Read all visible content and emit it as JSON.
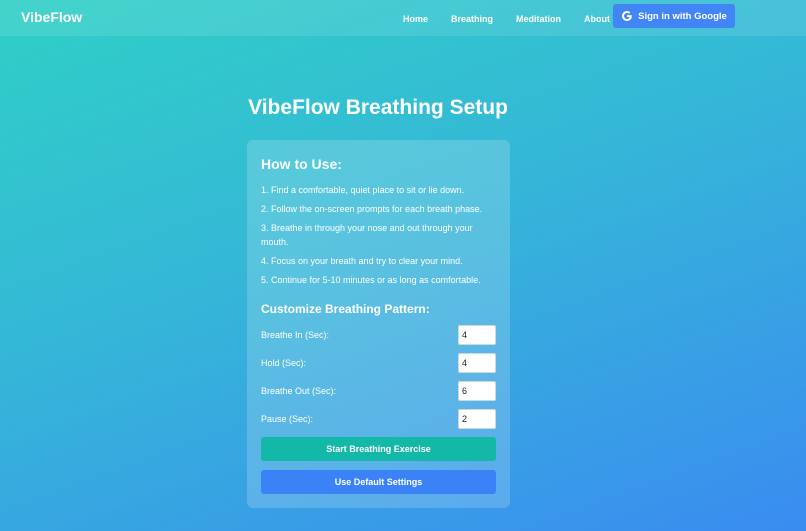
{
  "nav": {
    "brand": "VibeFlow",
    "links": [
      "Home",
      "Breathing",
      "Meditation",
      "About"
    ],
    "google_button": "Sign in with Google"
  },
  "main": {
    "title": "VibeFlow Breathing Setup",
    "how_to_use": {
      "heading": "How to Use:",
      "steps": [
        "1. Find a comfortable, quiet place to sit or lie down.",
        "2. Follow the on-screen prompts for each breath phase.",
        "3. Breathe in through your nose and out through your mouth.",
        "4. Focus on your breath and try to clear your mind.",
        "5. Continue for 5-10 minutes or as long as comfortable."
      ]
    },
    "customize": {
      "heading": "Customize Breathing Pattern:",
      "fields": [
        {
          "label": "Breathe In (Sec):",
          "value": "4"
        },
        {
          "label": "Hold (Sec):",
          "value": "4"
        },
        {
          "label": "Breathe Out (Sec):",
          "value": "6"
        },
        {
          "label": "Pause (Sec):",
          "value": "2"
        }
      ]
    },
    "start_button": "Start Breathing Exercise",
    "default_button": "Use Default Settings"
  },
  "colors": {
    "gradient_start": "#2fd0c6",
    "gradient_end": "#3a8cf0",
    "google_button": "#4285f4",
    "start_button": "#14b8a6",
    "default_button": "#3b82f6"
  },
  "icons": {
    "google": "google-g-icon"
  }
}
